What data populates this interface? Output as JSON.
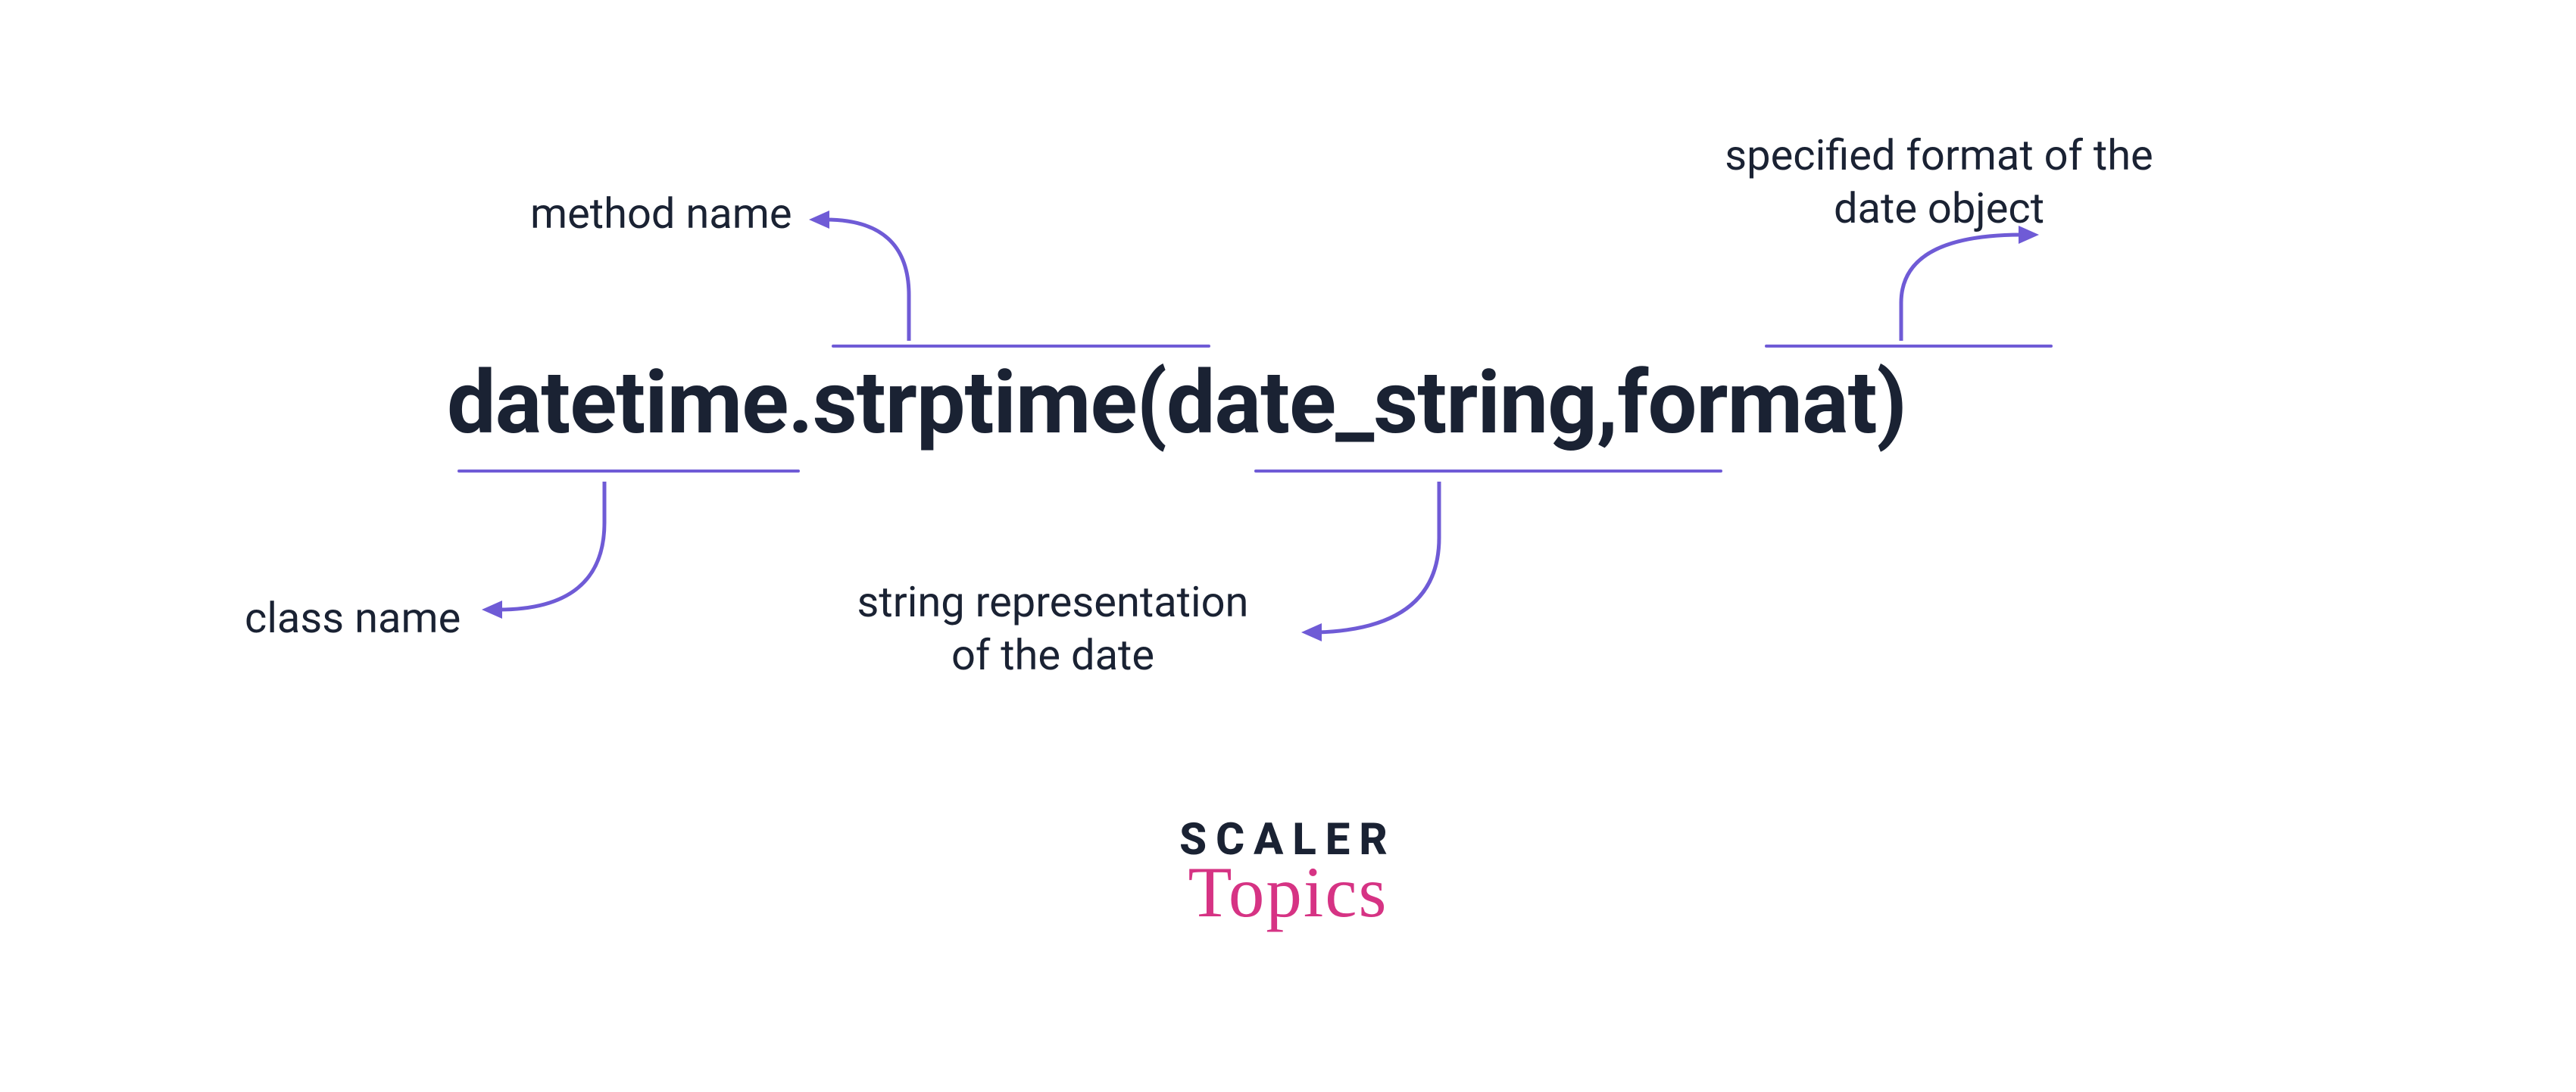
{
  "code": {
    "class_name": "datetime",
    "dot": ".",
    "method_name": "strptime",
    "open": "(",
    "arg1": "date_string",
    "comma": ",",
    "space": " ",
    "arg2": "format",
    "close": ")"
  },
  "annotations": {
    "class_name": "class name",
    "method_name": "method name",
    "arg1_line1": "string representation",
    "arg1_line2": "of the date",
    "arg2_line1": "specified format of the",
    "arg2_line2": "date object"
  },
  "logo": {
    "line1": "SCALER",
    "line2": "Topics"
  },
  "colors": {
    "text": "#1a2233",
    "accent": "#6f5bd6",
    "logo_pink": "#d63384"
  }
}
